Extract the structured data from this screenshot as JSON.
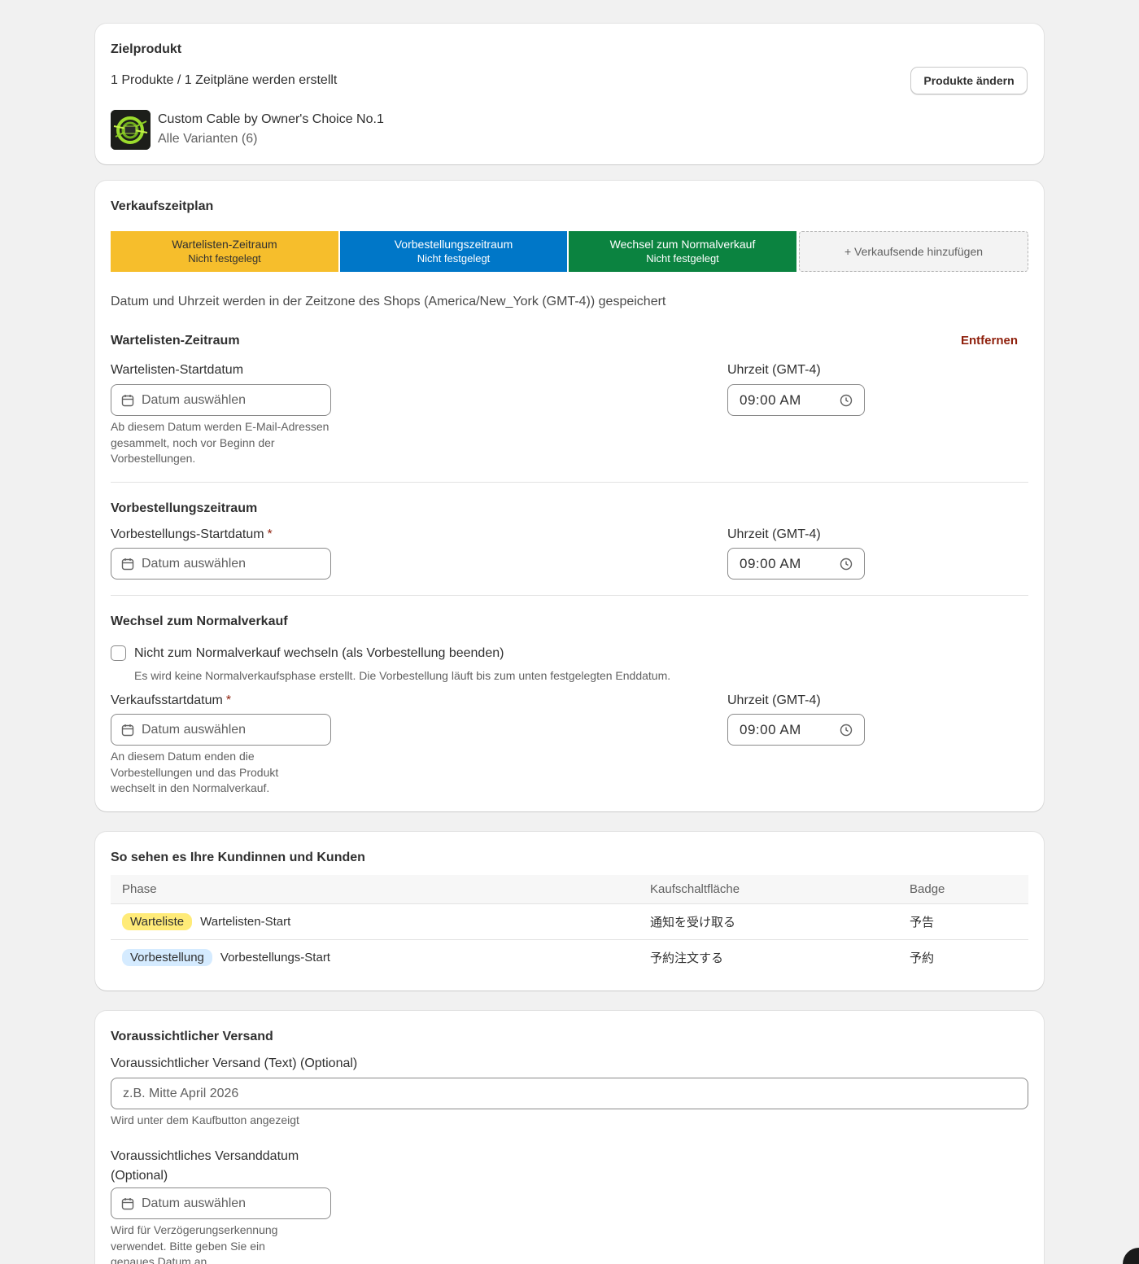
{
  "target": {
    "title": "Zielprodukt",
    "summary": "1 Produkte / 1 Zeitpläne werden erstellt",
    "change_button": "Produkte ändern",
    "product": {
      "name": "Custom Cable by Owner's Choice No.1",
      "variants": "Alle Varianten (6)"
    }
  },
  "schedule": {
    "title": "Verkaufszeitplan",
    "segments": [
      {
        "label": "Wartelisten-Zeitraum",
        "status": "Nicht festgelegt",
        "color": "#f6be2c"
      },
      {
        "label": "Vorbestellungszeitraum",
        "status": "Nicht festgelegt",
        "color": "#0077c8"
      },
      {
        "label": "Wechsel zum Normalverkauf",
        "status": "Nicht festgelegt",
        "color": "#0b8340"
      }
    ],
    "add_end": "+ Verkaufsende hinzufügen",
    "timezone_note": "Datum und Uhrzeit werden in der Zeitzone des Shops (America/New_York (GMT-4)) gespeichert",
    "waitlist": {
      "title": "Wartelisten-Zeitraum",
      "remove": "Entfernen",
      "date_label": "Wartelisten-Startdatum",
      "date_placeholder": "Datum auswählen",
      "help": "Ab diesem Datum werden E-Mail-Adressen gesammelt, noch vor Beginn der Vorbestellungen.",
      "time_label": "Uhrzeit (GMT-4)",
      "time_value": "09:00 AM"
    },
    "preorder": {
      "title": "Vorbestellungszeitraum",
      "date_label": "Vorbestellungs-Startdatum",
      "required": "*",
      "date_placeholder": "Datum auswählen",
      "time_label": "Uhrzeit (GMT-4)",
      "time_value": "09:00 AM"
    },
    "normal": {
      "title": "Wechsel zum Normalverkauf",
      "checkbox_label": "Nicht zum Normalverkauf wechseln (als Vorbestellung beenden)",
      "checkbox_help": "Es wird keine Normalverkaufsphase erstellt. Die Vorbestellung läuft bis zum unten festgelegten Enddatum.",
      "date_label": "Verkaufsstartdatum",
      "required": "*",
      "date_placeholder": "Datum auswählen",
      "help": "An diesem Datum enden die Vorbestellungen und das Produkt wechselt in den Normalverkauf.",
      "time_label": "Uhrzeit (GMT-4)",
      "time_value": "09:00 AM"
    }
  },
  "preview": {
    "title": "So sehen es Ihre Kundinnen und Kunden",
    "columns": [
      "Phase",
      "Kaufschaltfläche",
      "Badge"
    ],
    "rows": [
      {
        "badge": "Warteliste",
        "badge_color": "#ffeb78",
        "phase": "Wartelisten-Start",
        "button": "通知を受け取る",
        "label": "予告"
      },
      {
        "badge": "Vorbestellung",
        "badge_color": "#d5ebff",
        "phase": "Vorbestellungs-Start",
        "button": "予約注文する",
        "label": "予約"
      }
    ]
  },
  "shipping": {
    "title": "Voraussichtlicher Versand",
    "text_label": "Voraussichtlicher Versand (Text) (Optional)",
    "text_placeholder": "z.B. Mitte April 2026",
    "text_help": "Wird unter dem Kaufbutton angezeigt",
    "date_label": "Voraussichtliches Versanddatum (Optional)",
    "date_placeholder": "Datum auswählen",
    "date_help": "Wird für Verzögerungserkennung verwendet. Bitte geben Sie ein genaues Datum an."
  }
}
